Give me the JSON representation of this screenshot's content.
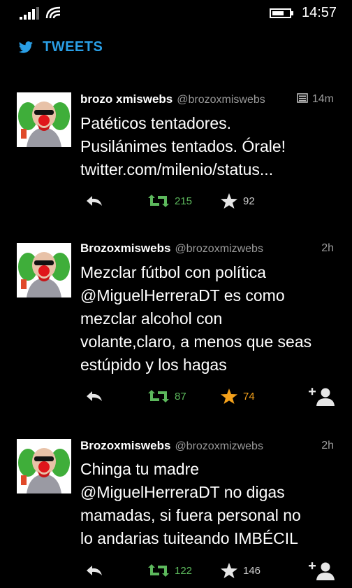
{
  "status": {
    "time": "14:57"
  },
  "header": {
    "title": "TWEETS",
    "icon": "twitter-bird-icon"
  },
  "colors": {
    "accent": "#2a9fe6",
    "retweet": "#5cb85c",
    "favorited": "#f4a11b",
    "secondary": "#9a9a9a"
  },
  "tweets": [
    {
      "name": "brozo xmiswebs",
      "handle": "@brozoxmiswebs",
      "time": "14m",
      "has_media": true,
      "lines": [
        "Patéticos tentadores.",
        "Pusilánimes tentados. Órale!",
        "twitter.com/milenio/status..."
      ],
      "retweets": "215",
      "favorites": "92",
      "favorited": false,
      "follow_button": false
    },
    {
      "name": "Brozoxmiswebs",
      "handle": "@brozoxmizwebs",
      "time": "2h",
      "has_media": false,
      "lines": [
        "Mezclar fútbol con política",
        "@MiguelHerreraDT es como",
        "mezclar alcohol con",
        "volante,claro, a menos que seas",
        "estúpido y los hagas"
      ],
      "retweets": "87",
      "favorites": "74",
      "favorited": true,
      "follow_button": true
    },
    {
      "name": "Brozoxmiswebs",
      "handle": "@brozoxmizwebs",
      "time": "2h",
      "has_media": false,
      "lines": [
        "Chinga tu madre",
        "@MiguelHerreraDT no digas",
        "mamadas, si fuera personal no",
        "lo andarias tuiteando IMBÉCIL"
      ],
      "retweets": "122",
      "favorites": "146",
      "favorited": false,
      "follow_button": true
    }
  ]
}
